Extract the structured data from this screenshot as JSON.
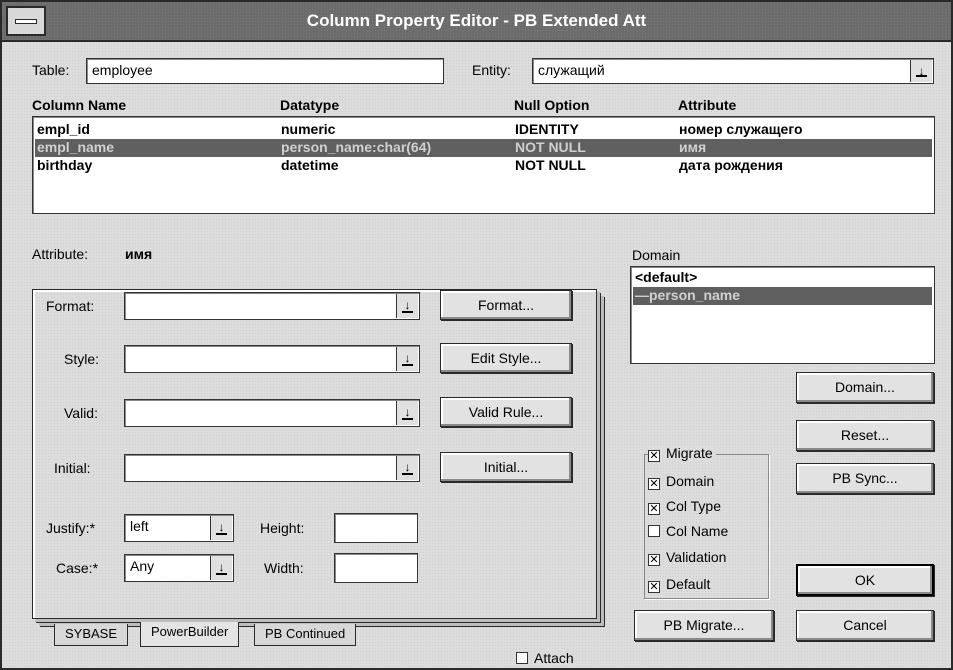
{
  "window": {
    "title": "Column Property Editor - PB Extended Att"
  },
  "table": {
    "label": "Table:",
    "value": "employee"
  },
  "entity": {
    "label": "Entity:",
    "value": "служащий"
  },
  "columns": {
    "headers": [
      "Column Name",
      "Datatype",
      "Null Option",
      "Attribute"
    ],
    "rows": [
      [
        "empl_id",
        "numeric",
        "IDENTITY",
        "номер служащего"
      ],
      [
        "empl_name",
        "person_name:char(64)",
        "NOT NULL",
        "имя"
      ],
      [
        "birthday",
        "datetime",
        "NOT NULL",
        "дата рождения"
      ]
    ],
    "selected_index": 1
  },
  "attribute": {
    "label": "Attribute:",
    "value": "имя"
  },
  "fields": {
    "format_label": "Format:",
    "format_value": "",
    "format_button": "Format...",
    "style_label": "Style:",
    "style_value": "",
    "style_button": "Edit Style...",
    "valid_label": "Valid:",
    "valid_value": "",
    "valid_button": "Valid Rule...",
    "initial_label": "Initial:",
    "initial_value": "",
    "initial_button": "Initial...",
    "justify_label": "Justify:*",
    "justify_value": "left",
    "case_label": "Case:*",
    "case_value": "Any",
    "height_label": "Height:",
    "height_value": "",
    "width_label": "Width:",
    "width_value": ""
  },
  "domain": {
    "label": "Domain",
    "items": [
      "<default>",
      "—person_name"
    ],
    "selected_index": 1
  },
  "buttons": {
    "domain": "Domain...",
    "reset": "Reset...",
    "pb_sync": "PB Sync...",
    "ok": "OK",
    "cancel": "Cancel",
    "pb_migrate": "PB Migrate..."
  },
  "migrate_group": {
    "title": "Migrate",
    "options": [
      {
        "label": "Domain",
        "checked": true
      },
      {
        "label": "Col Type",
        "checked": true
      },
      {
        "label": "Col Name",
        "checked": false
      },
      {
        "label": "Validation",
        "checked": true
      },
      {
        "label": "Default",
        "checked": true
      }
    ],
    "migrate_checked": true
  },
  "attach": {
    "label": "Attach",
    "checked": false
  },
  "tabs": [
    "SYBASE",
    "PowerBuilder",
    "PB Continued"
  ],
  "active_tab": "PowerBuilder"
}
